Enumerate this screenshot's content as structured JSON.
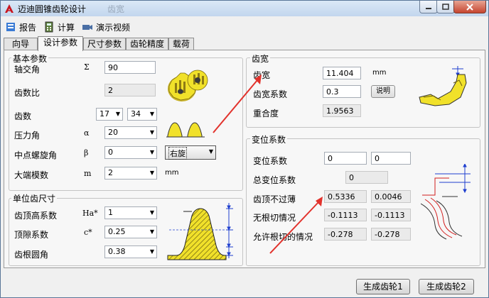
{
  "window": {
    "title": "迈迪圆锥齿轮设计",
    "ghost_title": "齿宽"
  },
  "toolbar": {
    "report_label": "报告",
    "calculate_label": "计算",
    "demo_label": "演示视频"
  },
  "tabs": [
    {
      "label": "向导"
    },
    {
      "label": "设计参数"
    },
    {
      "label": "尺寸参数"
    },
    {
      "label": "齿轮精度"
    },
    {
      "label": "载荷"
    }
  ],
  "basic_params": {
    "group_title": "基本参数",
    "shaft_angle": {
      "label": "轴交角",
      "symbol": "Σ",
      "value": "90"
    },
    "gear_ratio": {
      "label": "齿数比",
      "value": "2"
    },
    "teeth": {
      "label": "齿数",
      "value1": "17",
      "value2": "34"
    },
    "pressure_angle": {
      "label": "压力角",
      "symbol": "α",
      "value": "20"
    },
    "helix_angle": {
      "label": "中点螺旋角",
      "symbol": "β",
      "value": "0",
      "hand": "右旋"
    },
    "module": {
      "label": "大端模数",
      "symbol": "m",
      "value": "2",
      "unit": "mm"
    }
  },
  "unit_tooth": {
    "group_title": "单位齿尺寸",
    "addendum_coef": {
      "label": "齿顶高系数",
      "symbol": "Ha*",
      "value": "1"
    },
    "clearance_coef": {
      "label": "顶隙系数",
      "symbol": "c*",
      "value": "0.25"
    },
    "root_fillet": {
      "label": "齿根圆角",
      "value": "0.38"
    }
  },
  "face_width": {
    "group_title": "齿宽",
    "width": {
      "label": "齿宽",
      "value": "11.404",
      "unit": "mm"
    },
    "width_coef": {
      "label": "齿宽系数",
      "value": "0.3",
      "button": "说明"
    },
    "contact_ratio": {
      "label": "重合度",
      "value": "1.9563"
    }
  },
  "modification": {
    "group_title": "变位系数",
    "shift": {
      "label": "变位系数",
      "value1": "0",
      "value2": "0"
    },
    "total_shift": {
      "label": "总变位系数",
      "value": "0"
    },
    "tip_thin": {
      "label": "齿顶不过薄",
      "value1": "0.5336",
      "value2": "0.0046"
    },
    "no_undercut": {
      "label": "无根切情况",
      "value1": "-0.1113",
      "value2": "-0.1113"
    },
    "allow_undercut": {
      "label": "允许根切的情况",
      "value1": "-0.278",
      "value2": "-0.278"
    }
  },
  "footer": {
    "gen_gear1": "生成齿轮1",
    "gen_gear2": "生成齿轮2"
  },
  "colors": {
    "accent_blue": "#1f3fcf",
    "gear_yellow": "#f1e12a",
    "arrow_red": "#e2322c"
  }
}
